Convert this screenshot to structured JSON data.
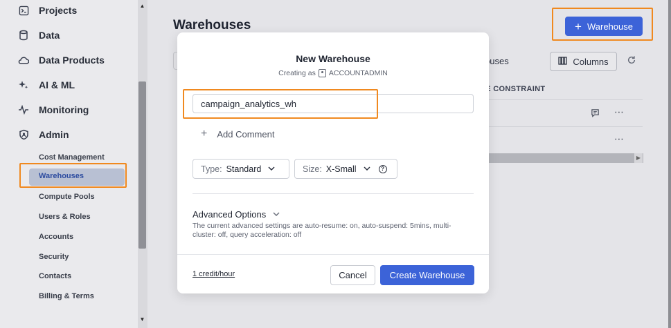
{
  "sidebar": {
    "nav_items": [
      {
        "label": "Projects",
        "icon": "terminal-icon"
      },
      {
        "label": "Data",
        "icon": "database-icon"
      },
      {
        "label": "Data Products",
        "icon": "cloud-icon"
      },
      {
        "label": "AI & ML",
        "icon": "sparkle-icon"
      },
      {
        "label": "Monitoring",
        "icon": "pulse-icon"
      },
      {
        "label": "Admin",
        "icon": "shield-icon"
      }
    ],
    "sub_items": [
      "Cost Management",
      "Warehouses",
      "Compute Pools",
      "Users & Roles",
      "Accounts",
      "Security",
      "Contacts",
      "Billing & Terms"
    ],
    "active_sub_item": "Warehouses"
  },
  "main": {
    "page_title": "Warehouses",
    "add_warehouse_label": "Warehouse",
    "partial_text": "ouses",
    "columns_label": "Columns",
    "column_header": "CE CONSTRAINT"
  },
  "modal": {
    "title": "New Warehouse",
    "creating_as_label": "Creating as",
    "role": "ACCOUNTADMIN",
    "name_value": "campaign_analytics_wh",
    "add_comment_label": "Add Comment",
    "type_label": "Type:",
    "type_value": "Standard",
    "size_label": "Size:",
    "size_value": "X-Small",
    "advanced_title": "Advanced Options",
    "advanced_desc": "The current advanced settings are auto-resume: on, auto-suspend: 5mins, multi-cluster: off, query acceleration: off",
    "credit_link": "1 credit/hour",
    "cancel_label": "Cancel",
    "create_label": "Create Warehouse"
  },
  "colors": {
    "accent": "#3c63d8",
    "highlight": "#f0891f"
  }
}
